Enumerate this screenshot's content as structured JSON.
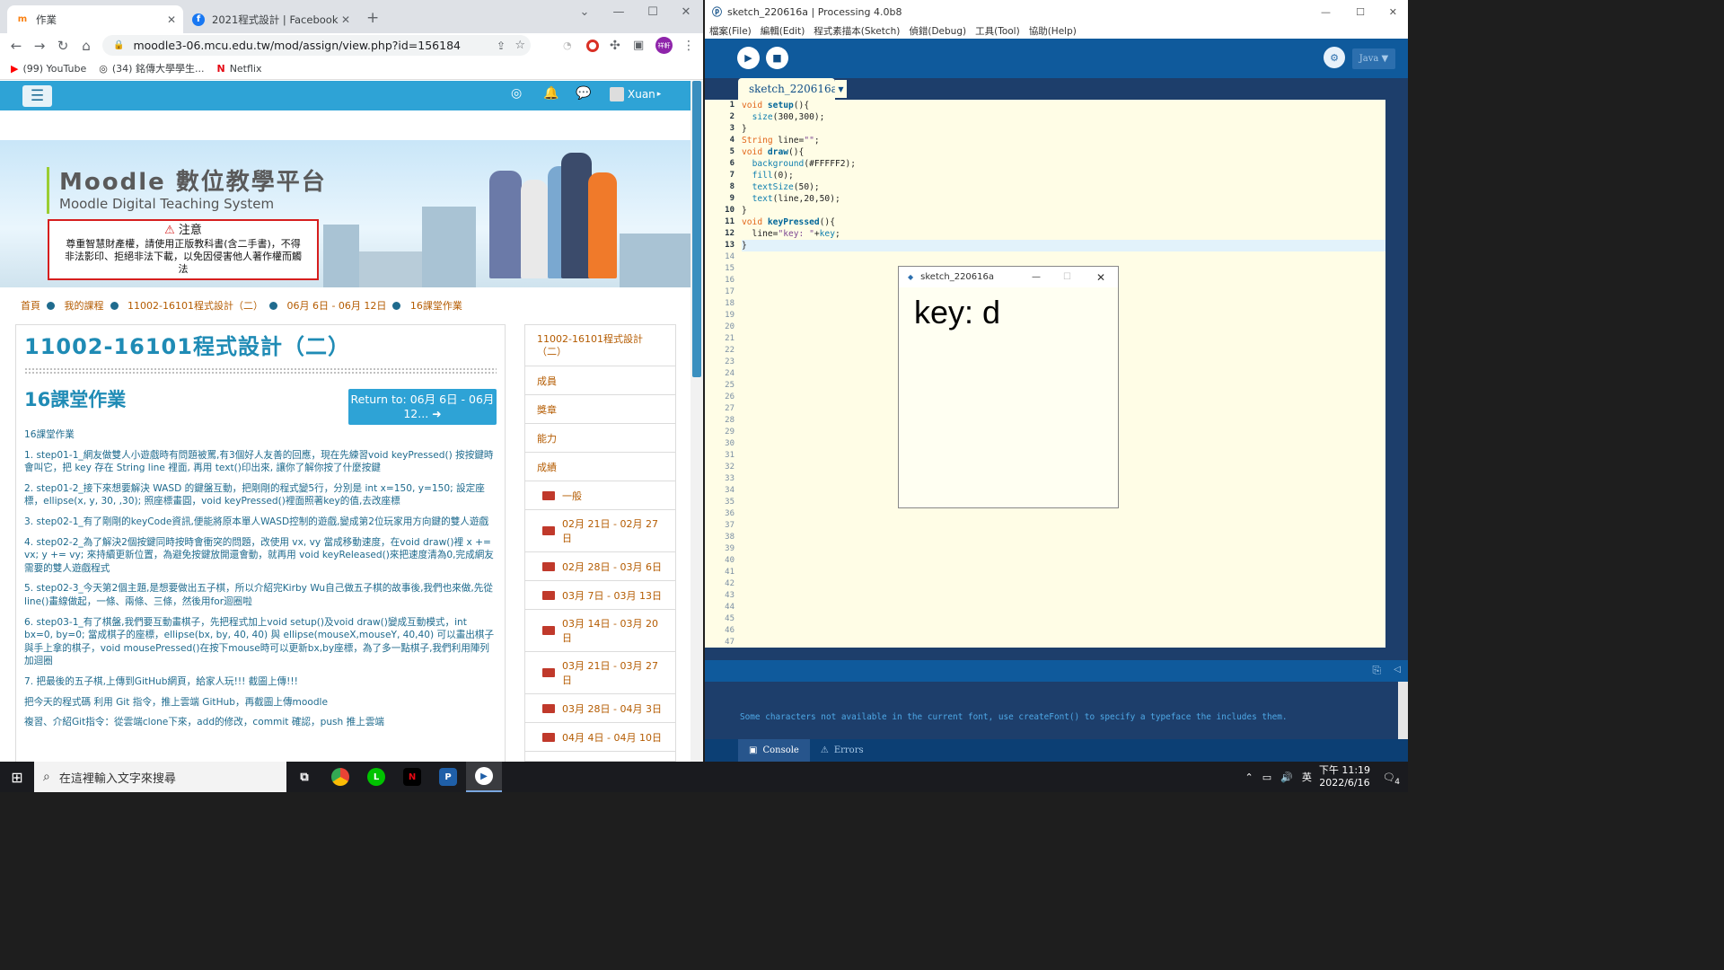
{
  "chrome": {
    "tabs": [
      {
        "label": "作業",
        "icon": "moodle-favicon"
      },
      {
        "label": "2021程式設計 | Facebook",
        "icon": "facebook-icon"
      }
    ],
    "url": "moodle3-06.mcu.edu.tw/mod/assign/view.php?id=156184",
    "bookmarks": [
      "(99) YouTube",
      "(34) 銘傳大學學生...",
      "Netflix"
    ],
    "profile": "祥軒"
  },
  "moodle": {
    "user": "Xuan",
    "banner_title": "Moodle 數位教學平台",
    "banner_sub": "Moodle Digital Teaching System",
    "notice_title": "注意",
    "notice_body": "尊重智慧財產權，請使用正版教科書(含二手書)，不得非法影印、拒絕非法下載，以免因侵害他人著作權而觸法",
    "breadcrumb": [
      "首頁",
      "我的課程",
      "11002-16101程式設計（二）",
      "06月 6日 - 06月 12日",
      "16課堂作業"
    ],
    "course_title": "11002-16101程式設計（二）",
    "assign_title": "16課堂作業",
    "return_button": "Return to: 06月 6日 - 06月 12...",
    "assign_label": "16課堂作業",
    "items": [
      "1. step01-1_網友做雙人小遊戲時有問題被罵,有3個好人友善的回應，現在先練習void keyPressed() 按按鍵時會叫它，把 key 存在 String line 裡面, 再用 text()印出來, 讓你了解你按了什麼按鍵",
      "2. step01-2_接下來想要解決 WASD 的鍵盤互動，把剛剛的程式變5行，分別是 int x=150, y=150; 設定座標，ellipse(x, y, 30, ,30); 照座標畫圓，void keyPressed()裡面照著key的值,去改座標",
      "3. step02-1_有了剛剛的keyCode資訊,便能將原本單人WASD控制的遊戲,變成第2位玩家用方向鍵的雙人遊戲",
      "4. step02-2_為了解決2個按鍵同時按時會衝突的問題，改使用 vx, vy 當成移動速度，在void draw()裡 x += vx; y += vy; 來持續更新位置，為避免按鍵放開還會動，就再用 void keyReleased()來把速度清為0,完成網友需要的雙人遊戲程式",
      "5. step02-3_今天第2個主題,是想要做出五子棋，所以介紹完Kirby Wu自己做五子棋的故事後,我們也來做,先從line()畫線做起，一條、兩條、三條，然後用for迴圈啦",
      "6. step03-1_有了棋盤,我們要互動畫棋子，先把程式加上void setup()及void draw()變成互動模式，int bx=0, by=0; 當成棋子的座標，ellipse(bx, by, 40, 40) 與 ellipse(mouseX,mouseY, 40,40) 可以畫出棋子與手上拿的棋子，void mousePressed()在按下mouse時可以更新bx,by座標，為了多一點棋子,我們利用陣列加迴圈",
      "7. 把最後的五子棋,上傳到GitHub網頁，給家人玩!!! 截圖上傳!!!",
      "把今天的程式碼 利用 Git 指令，推上雲端 GitHub，再截圖上傳moodle",
      "複習、介紹Git指令：從雲端clone下來，add的修改，commit 確認，push 推上雲端"
    ],
    "sidebar": [
      "11002-16101程式設計（二）",
      "成員",
      "獎章",
      "能力",
      "成績"
    ],
    "sidebar_weeks": [
      "一般",
      "02月 21日 - 02月 27日",
      "02月 28日 - 03月 6日",
      "03月 7日 - 03月 13日",
      "03月 14日 - 03月 20日",
      "03月 21日 - 03月 27日",
      "03月 28日 - 04月 3日",
      "04月 4日 - 04月 10日"
    ]
  },
  "processing": {
    "title": "sketch_220616a | Processing 4.0b8",
    "menu": [
      "檔案(File)",
      "編輯(Edit)",
      "程式素描本(Sketch)",
      "偵錯(Debug)",
      "工具(Tool)",
      "協助(Help)"
    ],
    "mode": "Java ▼",
    "tab": "sketch_220616a",
    "code": [
      "void setup(){",
      "  size(300,300);",
      "}",
      "String line=\"\";",
      "void draw(){",
      "  background(#FFFFF2);",
      "  fill(0);",
      "  textSize(50);",
      "  text(line,20,50);",
      "}",
      "void keyPressed(){",
      "  line=\"key: \"+key;",
      "}"
    ],
    "console": "Some characters not available in the current font, use createFont() to specify a typeface the includes them.",
    "console_tabs": [
      "Console",
      "Errors"
    ],
    "sketch_title": "sketch_220616a",
    "sketch_output": "key: d"
  },
  "taskbar": {
    "search": "在這裡輸入文字來搜尋",
    "time": "下午 11:19",
    "date": "2022/6/16",
    "ime": "英",
    "notif": "4"
  }
}
